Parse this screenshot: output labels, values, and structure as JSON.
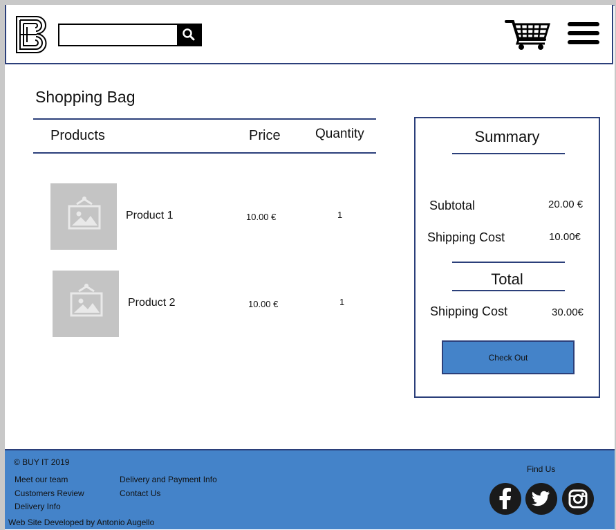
{
  "header": {
    "logo_letter": "B",
    "search": {
      "placeholder": "",
      "value": ""
    },
    "icons": [
      "logo-icon",
      "search-icon",
      "cart-icon",
      "hamburger-menu-icon"
    ]
  },
  "page_title": "Shopping Bag",
  "table": {
    "columns": [
      "Products",
      "Price",
      "Quantity"
    ],
    "rows": [
      {
        "name": "Product 1",
        "price": "10.00 €",
        "quantity": "1",
        "image": "image-placeholder-icon"
      },
      {
        "name": "Product 2",
        "price": "10.00 €",
        "quantity": "1",
        "image": "image-placeholder-icon"
      }
    ]
  },
  "summary": {
    "title": "Summary",
    "subtotal_label": "Subtotal",
    "subtotal_value": "20.00 €",
    "shipping_label": "Shipping Cost",
    "shipping_value": "10.00€",
    "total_title": "Total",
    "total_label": "Shipping Cost",
    "total_value": "30.00€",
    "checkout_label": "Check Out"
  },
  "footer": {
    "copyright": "© BUY IT 2019",
    "links_col1": [
      "Meet our team",
      "Customers Review",
      "Delivery Info"
    ],
    "links_col2": [
      "Delivery and Payment Info",
      "Contact Us"
    ],
    "credit": "Web Site Developed by Antonio Augello",
    "find_us": "Find Us",
    "social_icons": [
      "facebook-icon",
      "twitter-icon",
      "instagram-icon"
    ]
  },
  "colors": {
    "accent": "#4483c9",
    "border": "#2b3f7a",
    "placeholder": "#c4c4c4"
  }
}
